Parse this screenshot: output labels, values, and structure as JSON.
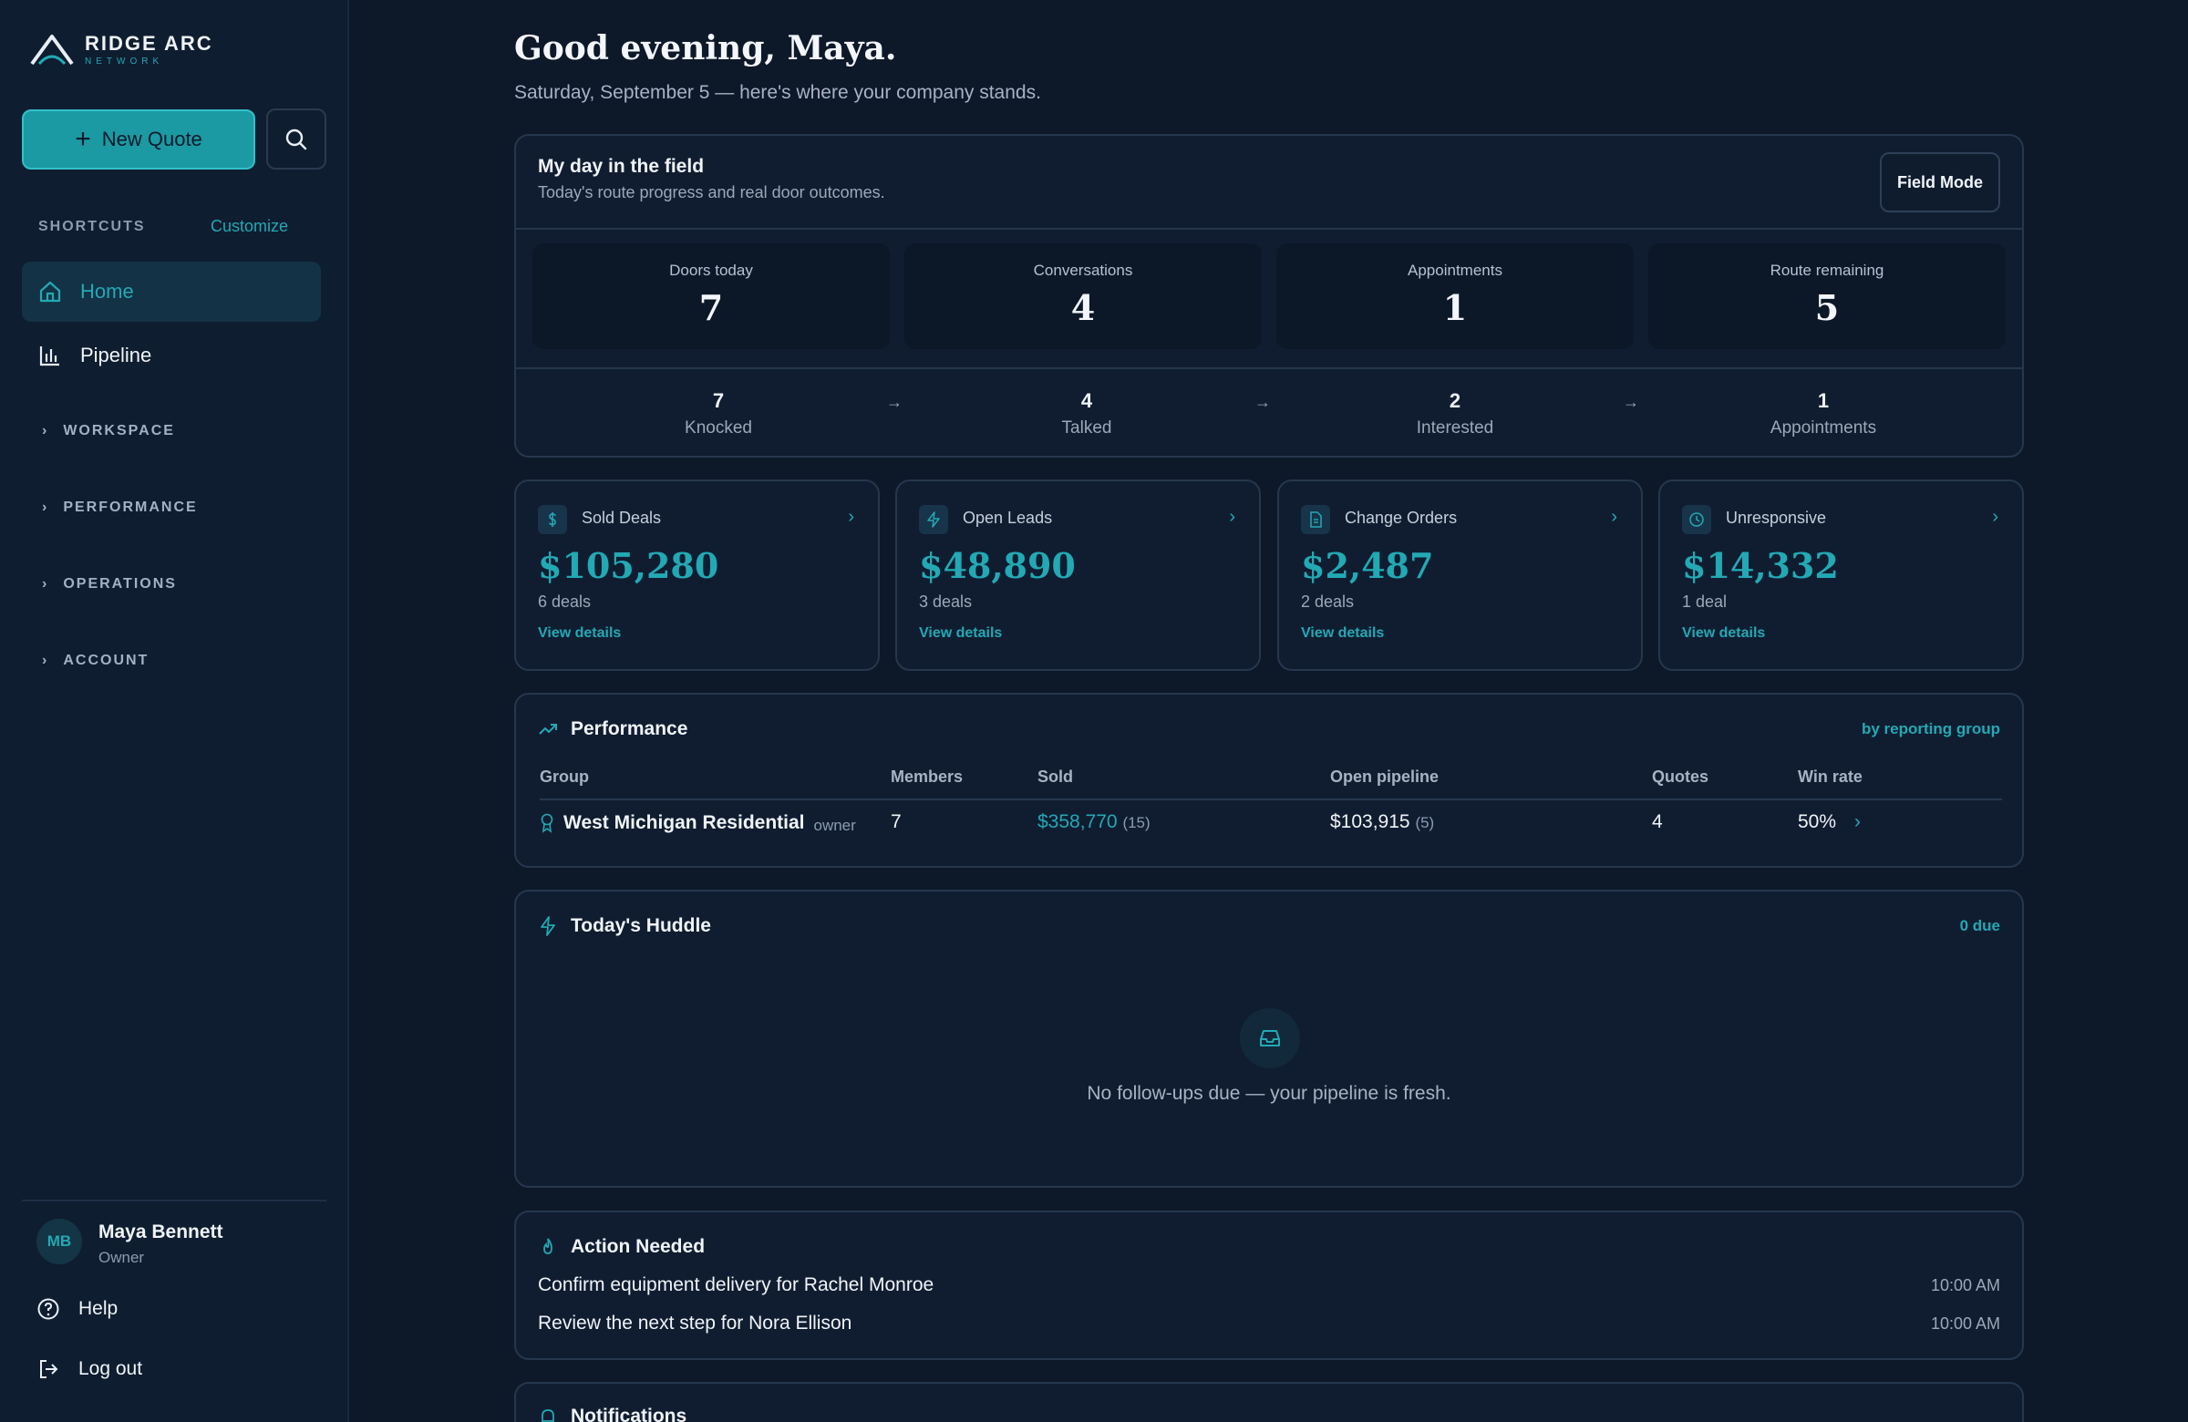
{
  "brand": {
    "name": "RIDGE ARC",
    "sub": "NETWORK"
  },
  "sidebar": {
    "new_quote": "New Quote",
    "shortcuts_label": "SHORTCUTS",
    "customize": "Customize",
    "nav": [
      {
        "label": "Home"
      },
      {
        "label": "Pipeline"
      }
    ],
    "sections": [
      "WORKSPACE",
      "PERFORMANCE",
      "OPERATIONS",
      "ACCOUNT"
    ],
    "user": {
      "initials": "MB",
      "name": "Maya Bennett",
      "role": "Owner"
    },
    "help": "Help",
    "logout": "Log out"
  },
  "header": {
    "greeting": "Good evening, Maya.",
    "subtitle": "Saturday, September 5 — here's where your company stands."
  },
  "field": {
    "title": "My day in the field",
    "subtitle": "Today's route progress and real door outcomes.",
    "button": "Field Mode",
    "stats": [
      {
        "label": "Doors today",
        "value": "7"
      },
      {
        "label": "Conversations",
        "value": "4"
      },
      {
        "label": "Appointments",
        "value": "1"
      },
      {
        "label": "Route remaining",
        "value": "5"
      }
    ],
    "arrow": "→",
    "funnel": [
      {
        "value": "7",
        "label": "Knocked"
      },
      {
        "value": "4",
        "label": "Talked"
      },
      {
        "value": "2",
        "label": "Interested"
      },
      {
        "value": "1",
        "label": "Appointments"
      }
    ]
  },
  "kpis": [
    {
      "icon": "dollar-icon",
      "label": "Sold Deals",
      "value": "$105,280",
      "count": "6 deals",
      "link": "View details"
    },
    {
      "icon": "bolt-icon",
      "label": "Open Leads",
      "value": "$48,890",
      "count": "3 deals",
      "link": "View details"
    },
    {
      "icon": "document-icon",
      "label": "Change Orders",
      "value": "$2,487",
      "count": "2 deals",
      "link": "View details"
    },
    {
      "icon": "clock-icon",
      "label": "Unresponsive",
      "value": "$14,332",
      "count": "1 deal",
      "link": "View details"
    }
  ],
  "performance": {
    "title": "Performance",
    "group_by": "by reporting group",
    "columns": [
      "Group",
      "Members",
      "Sold",
      "Open pipeline",
      "Quotes",
      "Win rate"
    ],
    "row": {
      "group": "West Michigan Residential",
      "role": "owner",
      "members": "7",
      "sold": "$358,770",
      "sold_count": "(15)",
      "open": "$103,915",
      "open_count": "(5)",
      "quotes": "4",
      "win_rate": "50%"
    }
  },
  "huddle": {
    "title": "Today's Huddle",
    "due": "0 due",
    "empty": "No follow-ups due — your pipeline is fresh."
  },
  "actions": {
    "title": "Action Needed",
    "items": [
      {
        "text": "Confirm equipment delivery for Rachel Monroe",
        "time": "10:00 AM"
      },
      {
        "text": "Review the next step for Nora Ellison",
        "time": "10:00 AM"
      }
    ]
  },
  "notifications": {
    "title": "Notifications"
  },
  "colors": {
    "accent": "#22a9b4",
    "background": "#0d1829",
    "card": "#101d31",
    "button": "#1b9aa3"
  }
}
